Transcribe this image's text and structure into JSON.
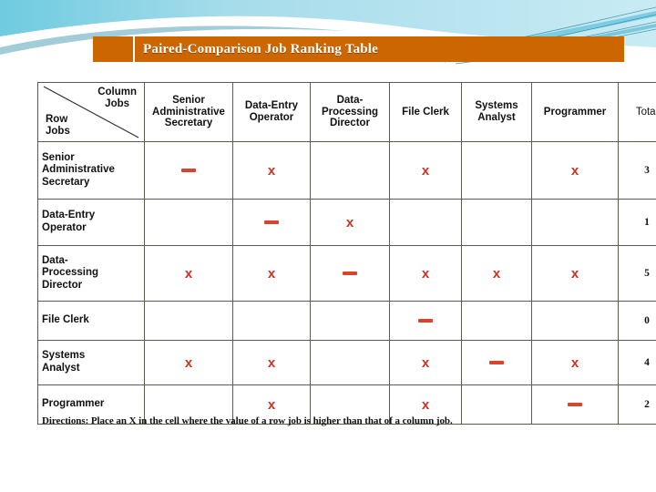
{
  "slide": {
    "title": "Paired-Comparison Job Ranking Table",
    "accent_color": "#CC6600",
    "deco_color_light": "#8ED8E8",
    "deco_color_mid": "#5BC2DC",
    "deco_color_dark": "#2E8FA8",
    "mark_color": "#CC3322",
    "dash_color": "#D8452E"
  },
  "table": {
    "corner": {
      "column_label": "Column\nJobs",
      "column_label_line1": "Column",
      "column_label_line2": "Jobs",
      "row_label_line1": "Row",
      "row_label_line2": "Jobs"
    },
    "columns": [
      "Senior Administrative Secretary",
      "Data-Entry Operator",
      "Data-Processing Director",
      "File Clerk",
      "Systems Analyst",
      "Programmer",
      "Total"
    ],
    "column_lines": [
      [
        "Senior",
        "Administrative",
        "Secretary"
      ],
      [
        "Data-Entry",
        "Operator"
      ],
      [
        "Data-",
        "Processing",
        "Director"
      ],
      [
        "File Clerk"
      ],
      [
        "Systems",
        "Analyst"
      ],
      [
        "Programmer"
      ],
      [
        "Total"
      ]
    ],
    "rows": [
      {
        "label_lines": [
          "Senior",
          "Administrative",
          "Secretary"
        ],
        "cells": [
          "dash",
          "x",
          "",
          "x",
          "",
          "x"
        ],
        "total": "3"
      },
      {
        "label_lines": [
          "Data-Entry",
          "Operator"
        ],
        "cells": [
          "",
          "dash",
          "x",
          "",
          "",
          ""
        ],
        "total": "1"
      },
      {
        "label_lines": [
          "Data-",
          "Processing",
          "Director"
        ],
        "cells": [
          "x",
          "x",
          "dash",
          "x",
          "x",
          "x"
        ],
        "total": "5"
      },
      {
        "label_lines": [
          "File Clerk"
        ],
        "cells": [
          "",
          "",
          "",
          "dash",
          "",
          ""
        ],
        "total": "0"
      },
      {
        "label_lines": [
          "Systems",
          "Analyst"
        ],
        "cells": [
          "x",
          "x",
          "",
          "x",
          "dash",
          "x"
        ],
        "total": "4"
      },
      {
        "label_lines": [
          "Programmer"
        ],
        "cells": [
          "",
          "x",
          "",
          "x",
          "",
          "dash"
        ],
        "total": "2"
      }
    ],
    "mark_glyph_x": "×",
    "mark_glyph_x_display": "x"
  },
  "directions": {
    "text": "Directions: Place an X in the cell where the value of a row job is higher than that of a column job."
  }
}
